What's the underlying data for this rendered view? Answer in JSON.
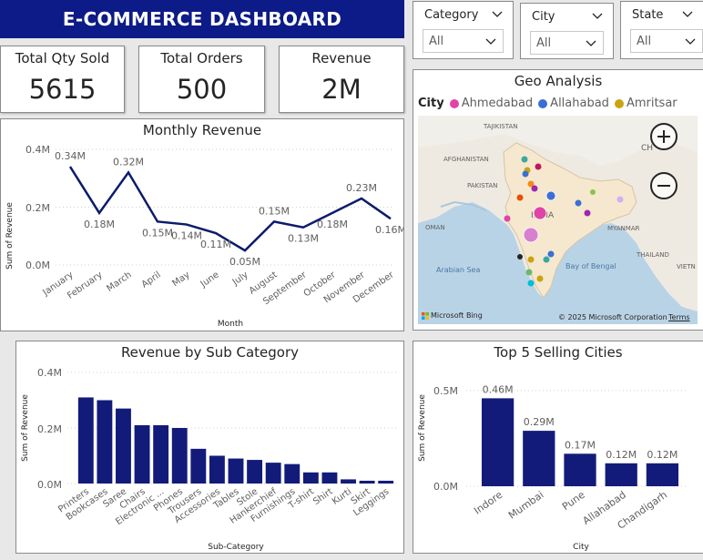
{
  "header": {
    "title": "E-COMMERCE DASHBOARD"
  },
  "kpis": [
    {
      "label": "Total Qty Sold",
      "value": "5615"
    },
    {
      "label": "Total Orders",
      "value": "500"
    },
    {
      "label": "Revenue",
      "value": "2M"
    }
  ],
  "slicers": [
    {
      "title": "Category",
      "value": "All"
    },
    {
      "title": "City",
      "value": "All"
    },
    {
      "title": "State",
      "value": "All"
    }
  ],
  "monthly_revenue": {
    "title": "Monthly Revenue",
    "ylabel": "Sum of Revenue",
    "xlabel": "Month",
    "y_ticks": [
      "0.4M",
      "0.2M",
      "0.0M"
    ]
  },
  "geo": {
    "title": "Geo Analysis",
    "legend_title": "City",
    "legend": [
      {
        "name": "Ahmedabad",
        "color": "#e044a7"
      },
      {
        "name": "Allahabad",
        "color": "#3b6fd4"
      },
      {
        "name": "Amritsar",
        "color": "#c9a40e"
      }
    ],
    "places": {
      "tajikistan": "TAJIKISTAN",
      "afghanistan": "AFGHANISTAN",
      "pakistan": "PAKISTAN",
      "india": "INDIA",
      "oman": "OMAN",
      "myanmar": "MYANMAR",
      "thailand": "THAILAND",
      "arabian_sea": "Arabian Sea",
      "bay_of_bengal": "Bay of Bengal",
      "china": "CH",
      "vietnam": "VIETN"
    },
    "credit_logo": "Microsoft Bing",
    "copyright": "© 2025 Microsoft Corporation",
    "terms": "Terms"
  },
  "subcategory": {
    "title": "Revenue by Sub Category",
    "ylabel": "Sum of Revenue",
    "xlabel": "Sub-Category",
    "y_ticks": [
      "0.4M",
      "0.2M",
      "0.0M"
    ]
  },
  "top_cities": {
    "title": "Top 5 Selling Cities",
    "ylabel": "Sum of Revenue",
    "xlabel": "City",
    "y_ticks": [
      "0.5M",
      "0.0M"
    ]
  },
  "chart_data": [
    {
      "id": "monthly",
      "type": "line",
      "title": "Monthly Revenue",
      "xlabel": "Month",
      "ylabel": "Sum of Revenue",
      "ylim": [
        0,
        0.4
      ],
      "color": "#0c1b6b",
      "categories": [
        "January",
        "February",
        "March",
        "April",
        "May",
        "June",
        "July",
        "August",
        "September",
        "October",
        "November",
        "December"
      ],
      "values": [
        0.34,
        0.18,
        0.32,
        0.15,
        0.14,
        0.11,
        0.05,
        0.15,
        0.13,
        0.18,
        0.23,
        0.16
      ],
      "labels": [
        "0.34M",
        "0.18M",
        "0.32M",
        "0.15M",
        "0.14M",
        "0.11M",
        "0.05M",
        "0.15M",
        "0.13M",
        "0.18M",
        "0.23M",
        "0.16M"
      ]
    },
    {
      "id": "subcat",
      "type": "bar",
      "title": "Revenue by Sub Category",
      "xlabel": "Sub-Category",
      "ylabel": "Sum of Revenue",
      "ylim": [
        0,
        0.4
      ],
      "color": "#131b7a",
      "categories": [
        "Printers",
        "Bookcases",
        "Saree",
        "Chairs",
        "Electronic ...",
        "Phones",
        "Trousers",
        "Accessories",
        "Tables",
        "Stole",
        "Hankerchief",
        "Furnishings",
        "T-shirt",
        "Shirt",
        "Kurti",
        "Skirt",
        "Leggings"
      ],
      "values": [
        0.31,
        0.3,
        0.27,
        0.21,
        0.21,
        0.2,
        0.125,
        0.1,
        0.09,
        0.085,
        0.075,
        0.07,
        0.04,
        0.04,
        0.015,
        0.01,
        0.01
      ]
    },
    {
      "id": "cities",
      "type": "bar",
      "title": "Top 5 Selling Cities",
      "xlabel": "City",
      "ylabel": "Sum of Revenue",
      "ylim": [
        0,
        0.5
      ],
      "color": "#131b7a",
      "categories": [
        "Indore",
        "Mumbai",
        "Pune",
        "Allahabad",
        "Chandigarh"
      ],
      "values": [
        0.46,
        0.29,
        0.17,
        0.12,
        0.12
      ],
      "labels": [
        "0.46M",
        "0.29M",
        "0.17M",
        "0.12M",
        "0.12M"
      ]
    }
  ]
}
